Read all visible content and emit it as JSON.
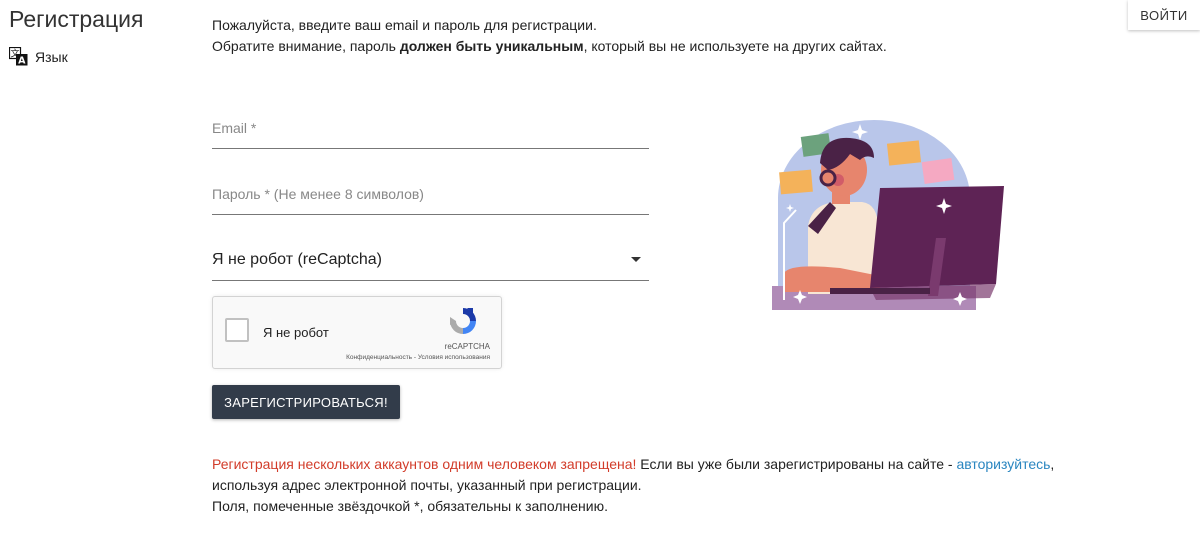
{
  "header": {
    "title": "Регистрация",
    "language_label": "Язык",
    "login_label": "ВОЙТИ"
  },
  "intro": {
    "line1": "Пожалуйста, введите ваш email и пароль для регистрации.",
    "line2_before": "Обратите внимание, пароль ",
    "line2_bold": "должен быть уникальным",
    "line2_after": ", который вы не используете на других сайтах."
  },
  "form": {
    "email_placeholder": "Email *",
    "email_value": "",
    "password_placeholder": "Пароль * (Не менее 8 символов)",
    "password_value": "",
    "captcha_select_value": "Я не робот (reCaptcha)",
    "captcha": {
      "checkbox_label": "Я не робот",
      "brand": "reCAPTCHA",
      "privacy_link": "Конфиденциальность",
      "separator": " - ",
      "terms_link": "Условия использования"
    },
    "submit_label": "ЗАРЕГИСТРИРОВАТЬСЯ!"
  },
  "notes": {
    "warning": "Регистрация нескольких аккаунтов одним человеком запрещена!",
    "text_before_link": " Если вы уже были зарегистрированы на сайте - ",
    "link_text": "авторизуйтесь",
    "text_after_link": ",",
    "line2": "используя адрес электронной почты, указанный при регистрации.",
    "line3": "Поля, помеченные звёздочкой *, обязательны к заполнению."
  },
  "icons": {
    "language": "translate-icon",
    "dropdown": "chevron-down-icon",
    "captcha_logo": "recaptcha-logo-icon"
  },
  "colors": {
    "submit_bg": "#323c4a",
    "warning": "#d23c2a",
    "link": "#2a86c0",
    "illustration_monitor": "#5e2355"
  }
}
